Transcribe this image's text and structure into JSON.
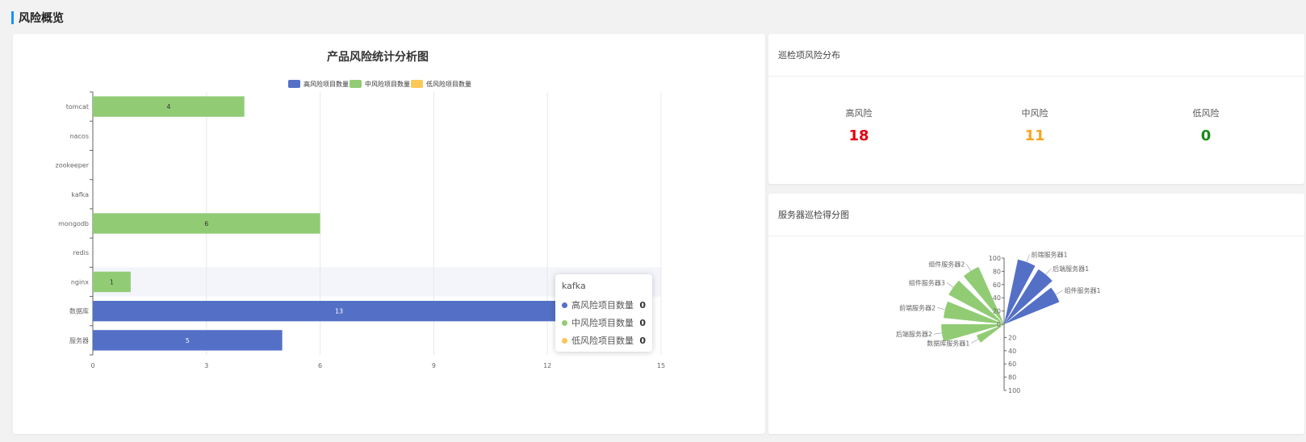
{
  "page": {
    "title": "风险概览",
    "accent": "#1890ff"
  },
  "risk_summary": {
    "title": "巡检项风险分布",
    "items": [
      {
        "label": "高风险",
        "value": "18",
        "color": "#e60012"
      },
      {
        "label": "中风险",
        "value": "11",
        "color": "#f5a623"
      },
      {
        "label": "低风险",
        "value": "0",
        "color": "#1a8a1a"
      }
    ]
  },
  "server_chart": {
    "title": "服务器巡检得分图"
  },
  "tooltip": {
    "title": "kafka",
    "rows": [
      {
        "name": "高风险项目数量",
        "value": "0",
        "color": "#5470c6"
      },
      {
        "name": "中风险项目数量",
        "value": "0",
        "color": "#91cc75"
      },
      {
        "name": "低风险项目数量",
        "value": "0",
        "color": "#fac858"
      }
    ]
  },
  "chart_data": [
    {
      "type": "bar",
      "orientation": "horizontal",
      "stacked": true,
      "title": "产品风险统计分析图",
      "categories": [
        "tomcat",
        "nacos",
        "zookeeper",
        "kafka",
        "mongodb",
        "redis",
        "nginx",
        "数据库",
        "服务器"
      ],
      "series": [
        {
          "name": "高风险项目数量",
          "color": "#5470c6",
          "values": [
            0,
            0,
            0,
            0,
            0,
            0,
            0,
            13,
            5
          ]
        },
        {
          "name": "中风险项目数量",
          "color": "#91cc75",
          "values": [
            4,
            0,
            0,
            0,
            6,
            0,
            1,
            0,
            0
          ]
        },
        {
          "name": "低风险项目数量",
          "color": "#fac858",
          "values": [
            0,
            0,
            0,
            0,
            0,
            0,
            0,
            0,
            0
          ]
        }
      ],
      "xlim": [
        0,
        15
      ],
      "xticks": [
        0,
        3,
        6,
        9,
        12,
        15
      ],
      "grid": true,
      "legend": "top-center",
      "highlighted_category": "nginx"
    },
    {
      "type": "polar-bar",
      "title": "服务器巡检得分图",
      "rticks": [
        0,
        20,
        40,
        60,
        80,
        100
      ],
      "rlim": [
        0,
        100
      ],
      "series": [
        {
          "color": "#5470c6",
          "points": [
            {
              "label": "前端服务器1",
              "value": 100
            },
            {
              "label": "后端服务器1",
              "value": 98
            },
            {
              "label": "组件服务器1",
              "value": 90
            }
          ]
        },
        {
          "color": "#91cc75",
          "points": [
            {
              "label": "数据库服务器1",
              "value": 45
            },
            {
              "label": "后端服务器2",
              "value": 95
            },
            {
              "label": "前端服务器2",
              "value": 92
            },
            {
              "label": "组件服务器3",
              "value": 95
            },
            {
              "label": "组件服务器2",
              "value": 95
            }
          ]
        }
      ]
    }
  ]
}
